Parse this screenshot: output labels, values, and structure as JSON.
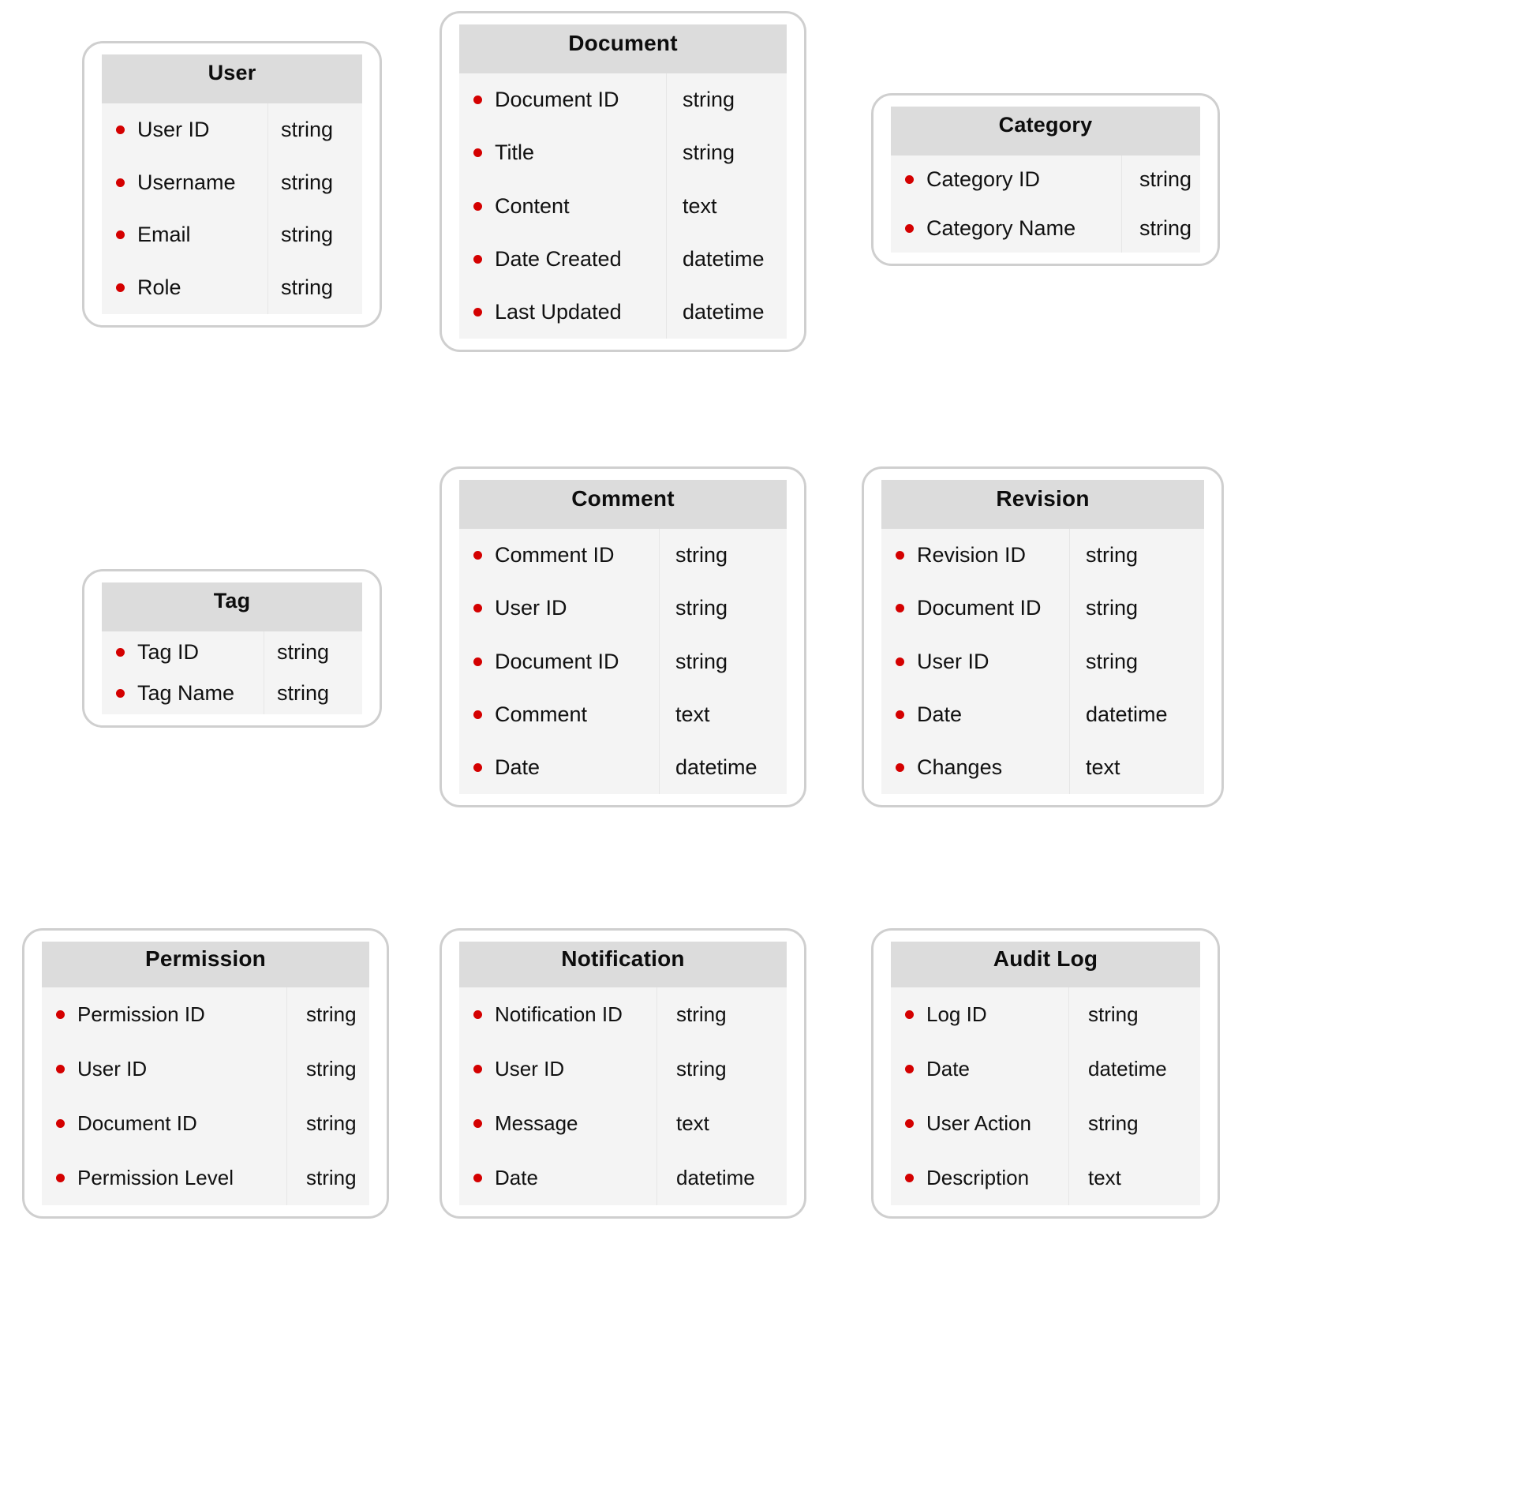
{
  "diagram": {
    "kind": "entity-relationship-diagram",
    "accent_bullet_color": "#d40000",
    "header_color": "#dcdcdc",
    "body_color": "#f4f4f4",
    "border_color": "#cfcfcf"
  },
  "entities": [
    {
      "name": "User",
      "attributes": [
        {
          "name": "User ID",
          "type": "string"
        },
        {
          "name": "Username",
          "type": "string"
        },
        {
          "name": "Email",
          "type": "string"
        },
        {
          "name": "Role",
          "type": "string"
        }
      ]
    },
    {
      "name": "Document",
      "attributes": [
        {
          "name": "Document ID",
          "type": "string"
        },
        {
          "name": "Title",
          "type": "string"
        },
        {
          "name": "Content",
          "type": "text"
        },
        {
          "name": "Date Created",
          "type": "datetime"
        },
        {
          "name": "Last Updated",
          "type": "datetime"
        }
      ]
    },
    {
      "name": "Category",
      "attributes": [
        {
          "name": "Category ID",
          "type": "string"
        },
        {
          "name": "Category Name",
          "type": "string"
        }
      ]
    },
    {
      "name": "Tag",
      "attributes": [
        {
          "name": "Tag ID",
          "type": "string"
        },
        {
          "name": "Tag Name",
          "type": "string"
        }
      ]
    },
    {
      "name": "Comment",
      "attributes": [
        {
          "name": "Comment ID",
          "type": "string"
        },
        {
          "name": "User ID",
          "type": "string"
        },
        {
          "name": "Document ID",
          "type": "string"
        },
        {
          "name": "Comment",
          "type": "text"
        },
        {
          "name": "Date",
          "type": "datetime"
        }
      ]
    },
    {
      "name": "Revision",
      "attributes": [
        {
          "name": "Revision ID",
          "type": "string"
        },
        {
          "name": "Document ID",
          "type": "string"
        },
        {
          "name": "User ID",
          "type": "string"
        },
        {
          "name": "Date",
          "type": "datetime"
        },
        {
          "name": "Changes",
          "type": "text"
        }
      ]
    },
    {
      "name": "Permission",
      "attributes": [
        {
          "name": "Permission ID",
          "type": "string"
        },
        {
          "name": "User ID",
          "type": "string"
        },
        {
          "name": "Document ID",
          "type": "string"
        },
        {
          "name": "Permission Level",
          "type": "string"
        }
      ]
    },
    {
      "name": "Notification",
      "attributes": [
        {
          "name": "Notification ID",
          "type": "string"
        },
        {
          "name": "User ID",
          "type": "string"
        },
        {
          "name": "Message",
          "type": "text"
        },
        {
          "name": "Date",
          "type": "datetime"
        }
      ]
    },
    {
      "name": "Audit Log",
      "attributes": [
        {
          "name": "Log ID",
          "type": "string"
        },
        {
          "name": "Date",
          "type": "datetime"
        },
        {
          "name": "User Action",
          "type": "string"
        },
        {
          "name": "Description",
          "type": "text"
        }
      ]
    }
  ]
}
